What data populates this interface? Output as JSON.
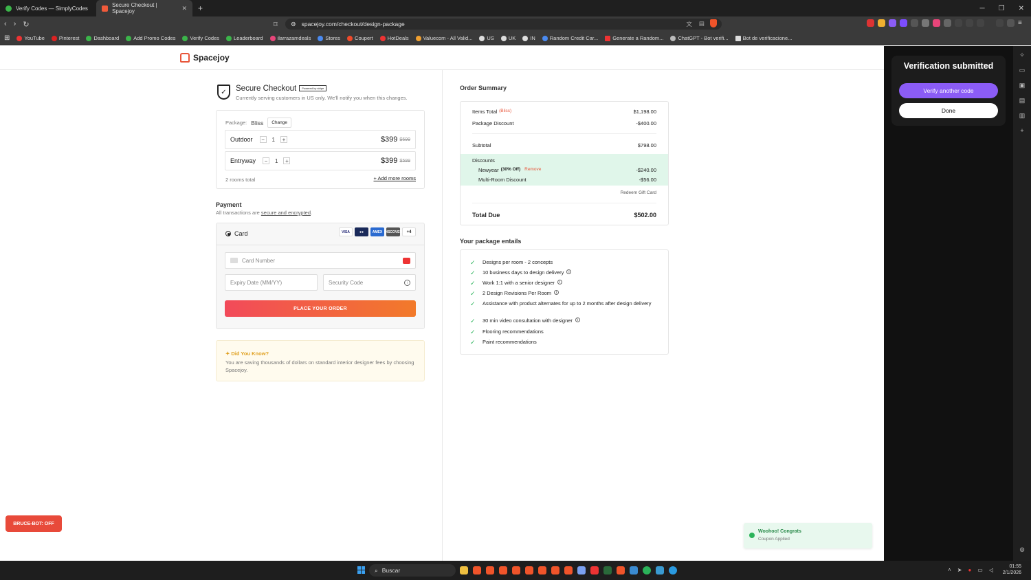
{
  "browser": {
    "tabs": [
      {
        "label": "Verify Codes — SimplyCodes",
        "active": false
      },
      {
        "label": "Secure Checkout | Spacejoy",
        "active": true
      }
    ],
    "url": "spacejoy.com/checkout/design-package",
    "bookmarks": [
      "YouTube",
      "Pinterest",
      "Dashboard",
      "Add Promo Codes",
      "Verify Codes",
      "Leaderboard",
      "ilarrazamdeals",
      "Stores",
      "Coupert",
      "HotDeals",
      "Valuecom - All Valid...",
      "US",
      "UK",
      "IN",
      "Random Credit Car...",
      "Generate a Random...",
      "ChatGPT - Bot verifi...",
      "Bot de verificacione..."
    ]
  },
  "site": {
    "brand": "Spacejoy",
    "colors": {
      "accent": "#e8553a",
      "place_order_start": "#f24a5a",
      "place_order_end": "#f27a2a",
      "discount_bg": "#e0f6ea",
      "verify_purple": "#8b5cf6"
    }
  },
  "checkout": {
    "title": "Secure Checkout",
    "stripe_badge": "Powered by stripe",
    "subtitle": "Currently serving customers in US only. We'll notify you when this changes.",
    "package_label": "Package:",
    "package_name": "Bliss",
    "change_label": "Change",
    "rooms": [
      {
        "name": "Outdoor",
        "qty": "1",
        "price": "$399",
        "orig": "$599"
      },
      {
        "name": "Entryway",
        "qty": "1",
        "price": "$399",
        "orig": "$599"
      }
    ],
    "rooms_total": "2 rooms total",
    "add_more": "+ Add more rooms"
  },
  "payment": {
    "title": "Payment",
    "sub_prefix": "All transactions are",
    "sub_link": "secure and encrypted",
    "sub_suffix": ".",
    "method": "Card",
    "brands": [
      "VISA",
      "MC",
      "AMEX",
      "DISCOVER"
    ],
    "more_brands": "+4",
    "card_number_placeholder": "Card Number",
    "expiry_placeholder": "Expiry Date (MM/YY)",
    "cvc_placeholder": "Security Code",
    "place_order": "PLACE YOUR ORDER"
  },
  "did_you_know": {
    "title": "Did You Know?",
    "body": "You are saving thousands of dollars on standard interior designer fees by choosing Spacejoy."
  },
  "order_summary": {
    "title": "Order Summary",
    "items_total_label": "Items Total",
    "items_total_tag": "(Bliss)",
    "items_total": "$1,198.00",
    "package_discount_label": "Package Discount",
    "package_discount": "-$400.00",
    "subtotal_label": "Subtotal",
    "subtotal": "$798.00",
    "discounts_label": "Discounts",
    "coupon_label": "Newyear",
    "coupon_tag": "(30% Off)",
    "remove_label": "Remove",
    "coupon_value": "-$240.00",
    "multi_room_label": "Multi-Room Discount",
    "multi_room_value": "-$56.00",
    "gift_card": "Redeem Gift Card",
    "total_label": "Total Due",
    "total": "$502.00"
  },
  "entails": {
    "title": "Your package entails",
    "items": [
      {
        "text": "Designs per room - 2 concepts",
        "info": false
      },
      {
        "text": "10 business days to design delivery",
        "info": true
      },
      {
        "text": "Work 1:1 with a senior designer",
        "info": true
      },
      {
        "text": "2 Design Revisions Per Room",
        "info": true
      },
      {
        "text": "Assistance with product alternates for up to 2 months after design delivery",
        "info": false
      },
      {
        "text": "30 min video consultation with designer",
        "info": true
      },
      {
        "text": "Flooring recommendations",
        "info": false
      },
      {
        "text": "Paint recommendations",
        "info": false
      }
    ]
  },
  "bruce_bot": "BRUCE-BOT: OFF",
  "toast": {
    "title": "Woohoo! Congrats",
    "body": "Coupon Applied"
  },
  "side_panel": {
    "title": "Verification submitted",
    "verify_another": "Verify another code",
    "done": "Done"
  },
  "taskbar": {
    "search": "Buscar",
    "time": "01:55",
    "date": "2/1/2026"
  }
}
